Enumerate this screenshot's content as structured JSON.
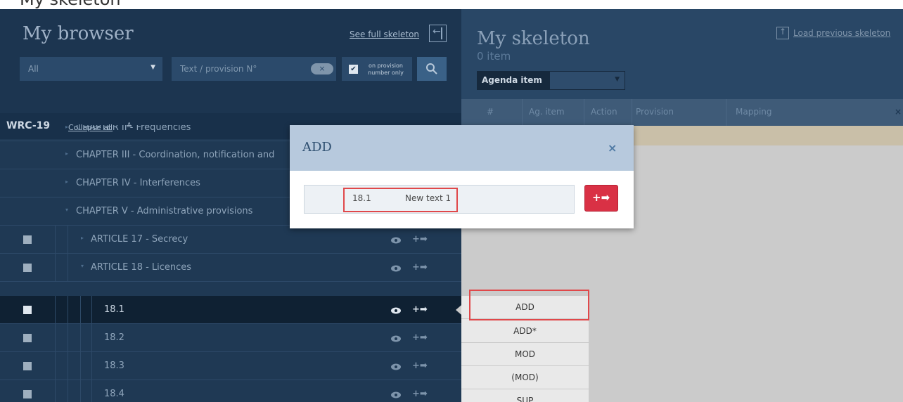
{
  "top_strip": {
    "caption": "My skeleton"
  },
  "browser": {
    "title": "My browser",
    "see_full_skeleton": "See full skeleton",
    "filter": {
      "value": "All"
    },
    "search": {
      "placeholder": "Text / provision N°",
      "clear_label": "×"
    },
    "provision_only": {
      "label": "on provision number only",
      "checked": true
    },
    "tree_title": "WRC-19",
    "collapse_all": "Collapse all",
    "rows": [
      {
        "label": "CHAPTER II - Frequencies",
        "has_checkbox": false
      },
      {
        "label": "CHAPTER III - Coordination, notification and",
        "has_checkbox": false
      },
      {
        "label": "CHAPTER IV - Interferences",
        "has_checkbox": false
      },
      {
        "label": "CHAPTER V - Administrative provisions",
        "has_checkbox": false
      },
      {
        "label": "ARTICLE 17 - Secrecy",
        "has_checkbox": true
      },
      {
        "label": "ARTICLE 18 - Licences",
        "has_checkbox": true
      },
      {
        "label": "18.1",
        "has_checkbox": true,
        "selected": true
      },
      {
        "label": "18.2",
        "has_checkbox": true
      },
      {
        "label": "18.3",
        "has_checkbox": true
      },
      {
        "label": "18.4",
        "has_checkbox": true
      }
    ]
  },
  "skeleton": {
    "title": "My skeleton",
    "count": "0 item",
    "agenda_label": "Agenda item",
    "agenda_value": "",
    "load_previous": "Load previous skeleton",
    "columns": [
      "#",
      "Ag. item",
      "Action",
      "Provision",
      "Mapping"
    ]
  },
  "modal": {
    "title": "ADD",
    "close": "×",
    "provision_number": "18.1",
    "provision_text": "New text 1",
    "add_icon": "+➡"
  },
  "action_menu": {
    "items": [
      "ADD",
      "ADD*",
      "MOD",
      "(MOD)",
      "SUP"
    ]
  },
  "colors": {
    "panel_dark": "#1f3954",
    "highlight_red": "#e0484a",
    "add_button": "#d93145"
  }
}
